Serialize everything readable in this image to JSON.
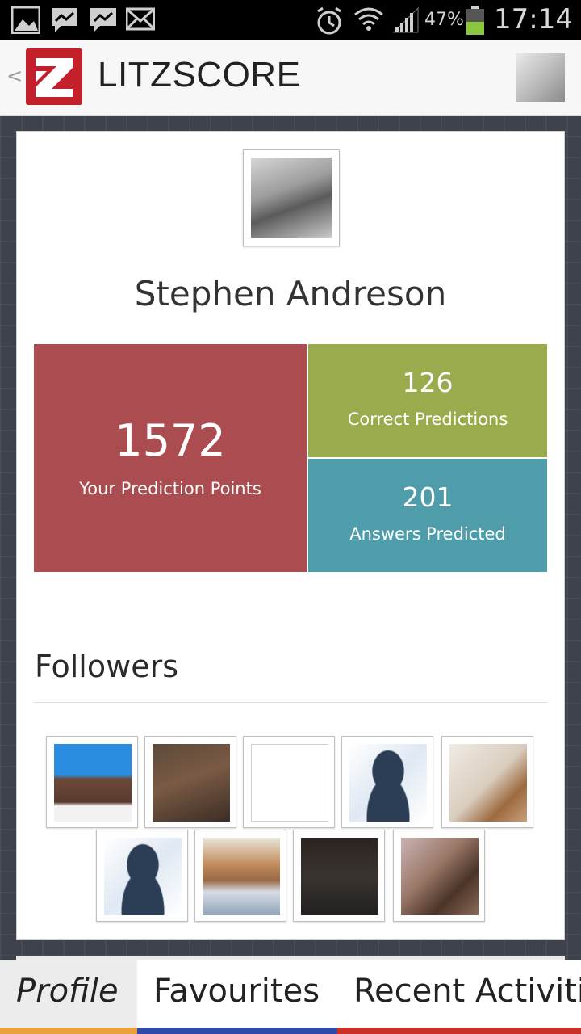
{
  "status_bar": {
    "battery_percent": "47%",
    "time": "17:14",
    "icons": [
      "gallery-icon",
      "messenger-icon",
      "messenger-icon",
      "mail-icon",
      "alarm-icon",
      "wifi-icon",
      "signal-icon",
      "battery-icon"
    ],
    "battery_level": 0.47
  },
  "app_bar": {
    "back": "<",
    "title": "LITZSCORE",
    "logo_letter": "Z"
  },
  "profile": {
    "name": "Stephen Andreson"
  },
  "stats": {
    "points_value": "1572",
    "points_label": "Your Prediction Points",
    "correct_value": "126",
    "correct_label": "Correct Predictions",
    "answers_value": "201",
    "answers_label": "Answers Predicted"
  },
  "followers": {
    "title": "Followers",
    "count_shown": 9
  },
  "tabs": [
    {
      "label": "Profile",
      "color": "#e8a23c",
      "active": true
    },
    {
      "label": "Favourites",
      "color": "#2f4aa8",
      "active": false
    },
    {
      "label": "Recent Activiti",
      "color": "#c93127",
      "active": false
    }
  ],
  "colors": {
    "points_tile": "#ab4d50",
    "correct_tile": "#9aab4d",
    "answers_tile": "#4f9dab",
    "logo": "#c4202c"
  }
}
